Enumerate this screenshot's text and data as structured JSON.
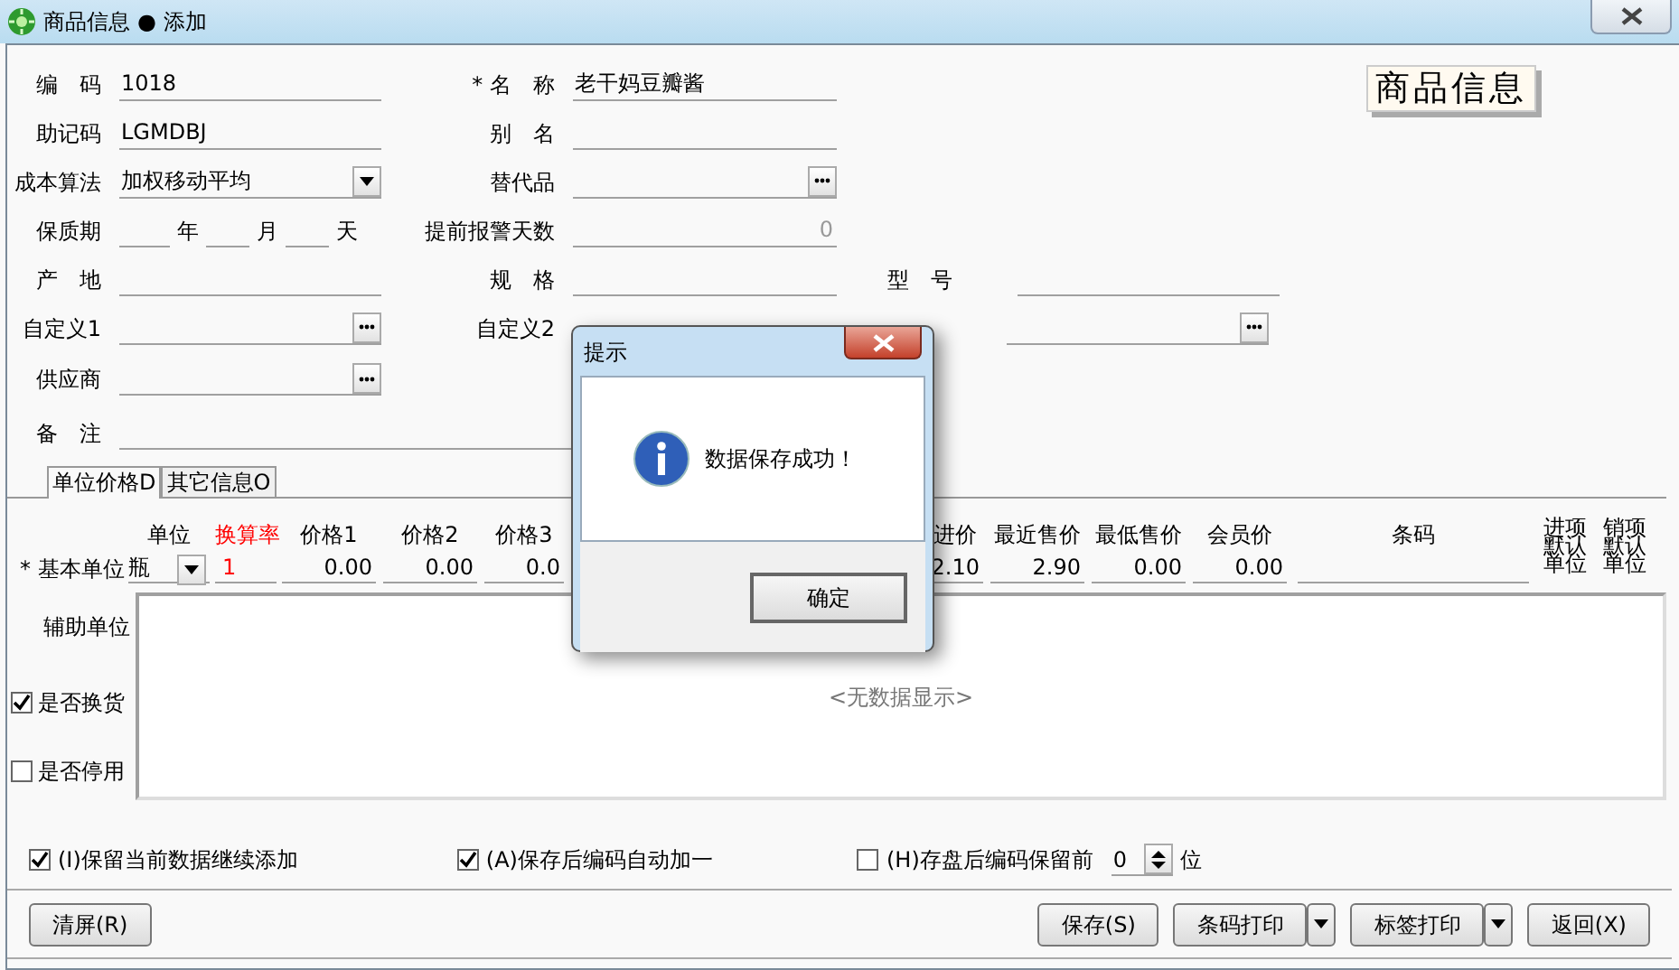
{
  "window": {
    "title": "商品信息",
    "separator": "●",
    "mode": "添加"
  },
  "logo": "商品信息",
  "form_rows": [
    [
      {
        "label": "编　码",
        "kind": "text",
        "value": "1018"
      },
      {
        "marker": "*",
        "label": "名　称",
        "kind": "text",
        "value": "老干妈豆瓣酱"
      }
    ],
    [
      {
        "label": "助记码",
        "kind": "text",
        "value": "LGMDBJ"
      },
      {
        "label": "别　名",
        "kind": "text"
      }
    ],
    [
      {
        "label": "成本算法",
        "kind": "select",
        "value": "加权移动平均"
      },
      {
        "label": "替代品",
        "kind": "browse"
      }
    ],
    [
      {
        "label": "保质期",
        "kind": "period",
        "units": [
          "年",
          "月",
          "天"
        ]
      },
      {
        "label": "提前报警天数",
        "kind": "number",
        "value": "0"
      }
    ],
    [
      {
        "label": "产　地",
        "kind": "text"
      },
      {
        "label": "规　格",
        "kind": "text"
      },
      {
        "label": "型　号",
        "kind": "text"
      }
    ],
    [
      {
        "label": "自定义1",
        "kind": "browse"
      },
      {
        "label": "自定义2",
        "kind": "label"
      },
      {
        "kind": "browse"
      }
    ],
    [
      {
        "label": "供应商",
        "kind": "browse"
      }
    ],
    [
      {
        "label": "备　注",
        "kind": "wide"
      }
    ]
  ],
  "tabs": [
    {
      "label": "单位价格D",
      "selected": true
    },
    {
      "label": "其它信息O",
      "selected": false
    }
  ],
  "units_grid": {
    "columns": [
      {
        "header": "单位"
      },
      {
        "header": "换算率",
        "color": "#ff0000"
      },
      {
        "header": "价格1"
      },
      {
        "header": "价格2"
      },
      {
        "header": "价格3"
      },
      {
        "header": "进价"
      },
      {
        "header": "最近售价"
      },
      {
        "header": "最低售价"
      },
      {
        "header": "会员价"
      },
      {
        "header": "条码"
      },
      {
        "header": "进项默认单位"
      },
      {
        "header": "销项默认单位"
      }
    ],
    "base_unit": {
      "marker": "*",
      "label": "基本单位",
      "values": [
        "瓶",
        "1",
        "0.00",
        "0.00",
        "0.0",
        "2.10",
        "2.90",
        "0.00",
        "0.00"
      ]
    },
    "aux_label": "辅助单位",
    "empty_text": "<无数据显示>",
    "flags": [
      {
        "label": "是否换货",
        "checked": true
      },
      {
        "label": "是否停用",
        "checked": false
      }
    ]
  },
  "options": [
    {
      "label": "(I)保留当前数据继续添加",
      "checked": true
    },
    {
      "label": "(A)保存后编码自动加一",
      "checked": true
    },
    {
      "label": "(H)存盘后编码保留前",
      "checked": false,
      "spin": "0",
      "suffix": "位"
    }
  ],
  "buttons_left": [
    {
      "label": "清屏(R)",
      "kind": "plain"
    }
  ],
  "buttons_right": [
    {
      "label": "保存(S)",
      "kind": "plain"
    },
    {
      "label": "条码打印",
      "kind": "split"
    },
    {
      "label": "标签打印",
      "kind": "split"
    },
    {
      "label": "返回(X)",
      "kind": "plain"
    }
  ],
  "dialog": {
    "title": "提示",
    "message": "数据保存成功！",
    "button": "确定"
  }
}
